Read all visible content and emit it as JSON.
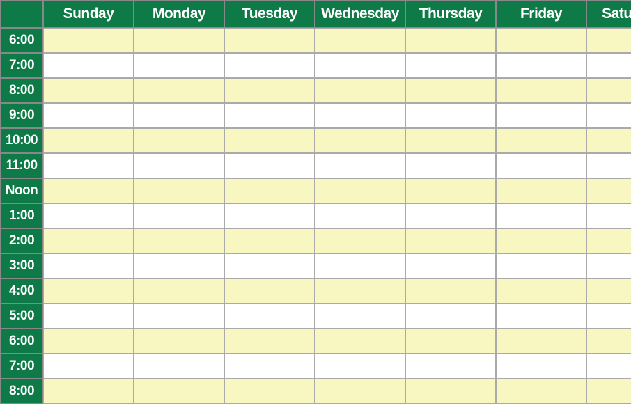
{
  "schedule": {
    "days": [
      "Sunday",
      "Monday",
      "Tuesday",
      "Wednesday",
      "Thursday",
      "Friday",
      "Saturday"
    ],
    "times": [
      "6:00",
      "7:00",
      "8:00",
      "9:00",
      "10:00",
      "11:00",
      "Noon",
      "1:00",
      "2:00",
      "3:00",
      "4:00",
      "5:00",
      "6:00",
      "7:00",
      "8:00"
    ],
    "colors": {
      "header_bg": "#0d7a48",
      "header_text": "#ffffff",
      "row_alt_a": "#f8f7c2",
      "row_alt_b": "#ffffff"
    }
  }
}
